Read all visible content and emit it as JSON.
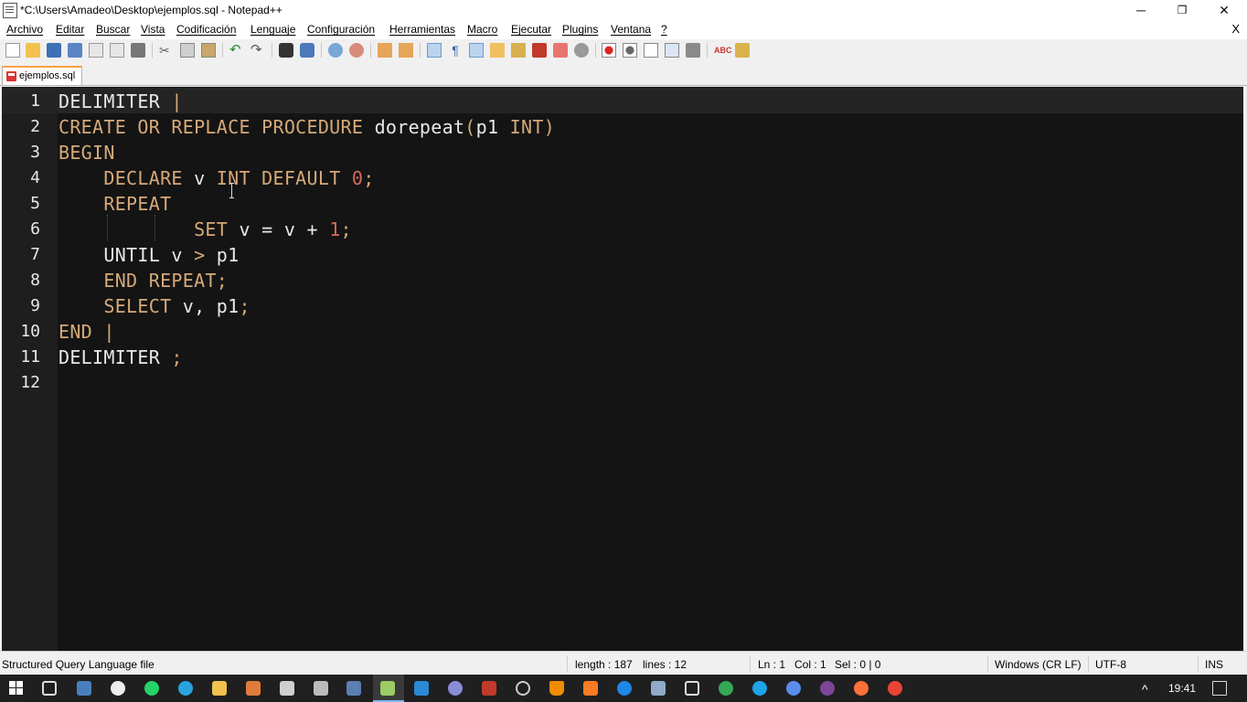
{
  "window": {
    "title": "*C:\\Users\\Amadeo\\Desktop\\ejemplos.sql - Notepad++",
    "minimize_icon": "minimize-icon",
    "restore_icon": "restore-icon",
    "close_icon": "close-icon",
    "minimize_glyph": "─",
    "restore_glyph": "❐",
    "close_glyph": "✕"
  },
  "menu": {
    "items": [
      "Archivo",
      "Editar",
      "Buscar",
      "Vista",
      "Codificación",
      "Lenguaje",
      "Configuración",
      "Herramientas",
      "Macro",
      "Ejecutar",
      "Plugins",
      "Ventana",
      "?"
    ],
    "close_doc": "X"
  },
  "toolbar": {
    "icons": [
      "new-file-icon",
      "open-file-icon",
      "save-icon",
      "save-all-icon",
      "close-icon",
      "close-all-icon",
      "print-icon",
      "cut-icon",
      "copy-icon",
      "paste-icon",
      "undo-icon",
      "redo-icon",
      "find-icon",
      "replace-icon",
      "zoom-in-icon",
      "zoom-out-icon",
      "sync-vertical-icon",
      "sync-horizontal-icon",
      "word-wrap-icon",
      "show-all-chars-icon",
      "indent-guide-icon",
      "udl-icon",
      "doc-map-icon",
      "function-list-icon",
      "folder-workspace-icon",
      "monitoring-icon",
      "record-macro-icon",
      "stop-record-icon",
      "play-macro-icon",
      "run-macro-multiple-icon",
      "save-macro-icon",
      "spell-check-icon",
      "plugin-icon"
    ]
  },
  "tab": {
    "label": "ejemplos.sql"
  },
  "editor": {
    "lines": [
      {
        "n": "1",
        "tokens": [
          [
            "DELIMITER ",
            "plain"
          ],
          [
            "|",
            "caret"
          ]
        ]
      },
      {
        "n": "2",
        "tokens": [
          [
            "CREATE OR REPLACE PROCEDURE ",
            "kw"
          ],
          [
            "dorepeat",
            "plain"
          ],
          [
            "(",
            "kw"
          ],
          [
            "p1 ",
            "plain"
          ],
          [
            "INT",
            "kw"
          ],
          [
            ")",
            "kw"
          ]
        ]
      },
      {
        "n": "3",
        "tokens": [
          [
            "BEGIN",
            "kw"
          ]
        ]
      },
      {
        "n": "4",
        "tokens": [
          [
            "    DECLARE ",
            "kw"
          ],
          [
            "v ",
            "plain"
          ],
          [
            "INT DEFAULT ",
            "kw"
          ],
          [
            "0",
            "num"
          ],
          [
            ";",
            "kw"
          ]
        ]
      },
      {
        "n": "5",
        "tokens": [
          [
            "    REPEAT",
            "kw"
          ]
        ]
      },
      {
        "n": "6",
        "tokens": [
          [
            "            SET ",
            "kw"
          ],
          [
            "v = v + ",
            "plain"
          ],
          [
            "1",
            "num"
          ],
          [
            ";",
            "kw"
          ]
        ]
      },
      {
        "n": "7",
        "tokens": [
          [
            "    UNTIL v ",
            "plain"
          ],
          [
            ">",
            "kw"
          ],
          [
            " p1",
            "plain"
          ]
        ]
      },
      {
        "n": "8",
        "tokens": [
          [
            "    END REPEAT;",
            "kw"
          ]
        ]
      },
      {
        "n": "9",
        "tokens": [
          [
            "    SELECT ",
            "kw"
          ],
          [
            "v, p1",
            "plain"
          ],
          [
            ";",
            "kw"
          ]
        ]
      },
      {
        "n": "10",
        "tokens": [
          [
            "END ",
            "kw"
          ],
          [
            "|",
            "delim"
          ]
        ]
      },
      {
        "n": "11",
        "tokens": [
          [
            "DELIMITER ",
            "plain"
          ],
          [
            ";",
            "kw"
          ]
        ]
      },
      {
        "n": "12",
        "tokens": []
      }
    ]
  },
  "status": {
    "file_type": "Structured Query Language file",
    "length": "length : 187",
    "lines": "lines : 12",
    "ln": "Ln : 1",
    "col": "Col : 1",
    "sel": "Sel : 0 | 0",
    "eol": "Windows (CR LF)",
    "encoding": "UTF-8",
    "mode": "INS"
  },
  "taskbar": {
    "apps": [
      "start-icon",
      "task-view-icon",
      "keyboard-icon",
      "unity-icon",
      "whatsapp-icon",
      "telegram-icon",
      "file-explorer-icon",
      "books-icon",
      "terminal-icon",
      "gamepad-icon",
      "sticky-notes-icon",
      "notepad-plus-plus-icon",
      "vscode-icon",
      "db-icon",
      "filezilla-icon",
      "github-icon",
      "vlc-icon",
      "xampp-icon",
      "media-player-icon",
      "remote-desktop-icon",
      "virtualbox-icon",
      "edge-icon",
      "ie-icon",
      "chrome-canary-icon",
      "tor-icon",
      "firefox-icon",
      "chrome-icon"
    ],
    "time": "19:41",
    "tray_chevron": "^"
  }
}
